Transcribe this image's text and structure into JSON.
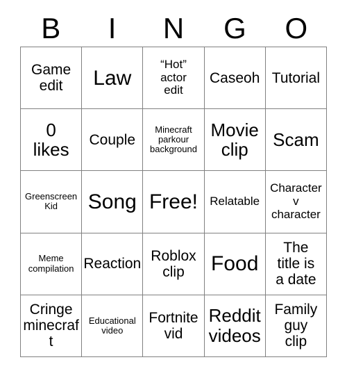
{
  "card": {
    "header_letters": [
      "B",
      "I",
      "N",
      "G",
      "O"
    ],
    "colors": {
      "background": "#ffffff",
      "text": "#000000",
      "grid_line": "#808080"
    },
    "grid_size": "5x5",
    "cells": [
      {
        "text": "Game\nedit",
        "size": "md",
        "name": "cell-b1"
      },
      {
        "text": "Law",
        "size": "xl",
        "name": "cell-i1"
      },
      {
        "text": "“Hot”\nactor\nedit",
        "size": "sm",
        "name": "cell-n1"
      },
      {
        "text": "Caseoh",
        "size": "md",
        "name": "cell-g1"
      },
      {
        "text": "Tutorial",
        "size": "md",
        "name": "cell-o1"
      },
      {
        "text": "0\nlikes",
        "size": "lg",
        "name": "cell-b2"
      },
      {
        "text": "Couple",
        "size": "md",
        "name": "cell-i2"
      },
      {
        "text": "Minecraft\nparkour\nbackground",
        "size": "xs",
        "name": "cell-n2"
      },
      {
        "text": "Movie\nclip",
        "size": "lg",
        "name": "cell-g2"
      },
      {
        "text": "Scam",
        "size": "lg",
        "name": "cell-o2"
      },
      {
        "text": "Greenscreen\nKid",
        "size": "xs",
        "name": "cell-b3"
      },
      {
        "text": "Song",
        "size": "xl",
        "name": "cell-i3"
      },
      {
        "text": "Free!",
        "size": "xl",
        "name": "cell-n3"
      },
      {
        "text": "Relatable",
        "size": "sm",
        "name": "cell-g3"
      },
      {
        "text": "Character\nv\ncharacter",
        "size": "sm",
        "name": "cell-o3"
      },
      {
        "text": "Meme\ncompilation",
        "size": "xs",
        "name": "cell-b4"
      },
      {
        "text": "Reaction",
        "size": "md",
        "name": "cell-i4"
      },
      {
        "text": "Roblox\nclip",
        "size": "md",
        "name": "cell-n4"
      },
      {
        "text": "Food",
        "size": "xl",
        "name": "cell-g4"
      },
      {
        "text": "The\ntitle is\na date",
        "size": "md",
        "name": "cell-o4"
      },
      {
        "text": "Cringe\nminecraft",
        "size": "md",
        "name": "cell-b5"
      },
      {
        "text": "Educational\nvideo",
        "size": "xs",
        "name": "cell-i5"
      },
      {
        "text": "Fortnite\nvid",
        "size": "md",
        "name": "cell-n5"
      },
      {
        "text": "Reddit\nvideos",
        "size": "lg",
        "name": "cell-g5"
      },
      {
        "text": "Family\nguy\nclip",
        "size": "md",
        "name": "cell-o5"
      }
    ]
  }
}
